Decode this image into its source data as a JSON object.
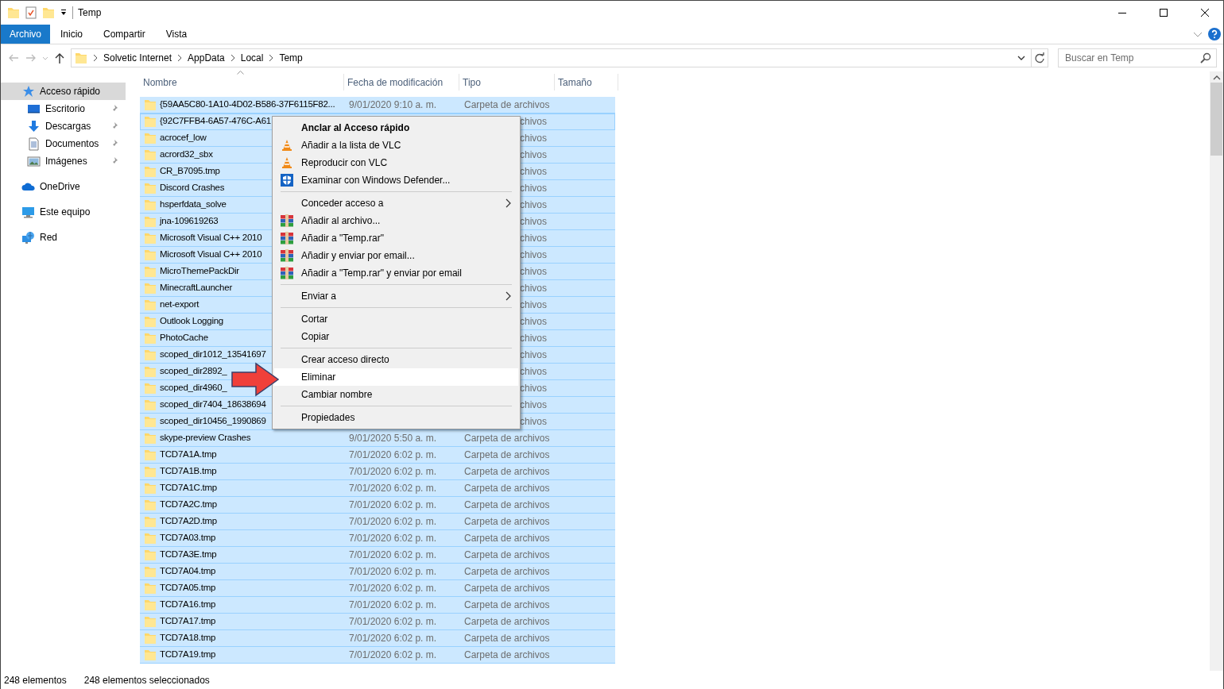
{
  "window": {
    "title": "Temp"
  },
  "ribbon_tabs": [
    {
      "label": "Archivo",
      "selected": true
    },
    {
      "label": "Inicio",
      "selected": false
    },
    {
      "label": "Compartir",
      "selected": false
    },
    {
      "label": "Vista",
      "selected": false
    }
  ],
  "address": {
    "crumbs": [
      "Solvetic Internet",
      "AppData",
      "Local",
      "Temp"
    ]
  },
  "search": {
    "placeholder": "Buscar en Temp"
  },
  "sidebar": {
    "items": [
      {
        "label": "Acceso rápido",
        "selected": true,
        "children": [
          {
            "label": "Escritorio",
            "pinned": true,
            "selected": false
          },
          {
            "label": "Descargas",
            "pinned": true,
            "selected": false
          },
          {
            "label": "Documentos",
            "pinned": true,
            "selected": false
          },
          {
            "label": "Imágenes",
            "pinned": true,
            "selected": false
          }
        ]
      },
      {
        "label": "OneDrive",
        "selected": false
      },
      {
        "label": "Este equipo",
        "selected": false
      },
      {
        "label": "Red",
        "selected": false
      }
    ]
  },
  "table": {
    "columns": [
      "Nombre",
      "Fecha de modificación",
      "Tipo",
      "Tamaño"
    ],
    "rows": [
      {
        "name": "{59AA5C80-1A10-4D02-B586-37F6115F82...",
        "date": "9/01/2020 9:10 a. m.",
        "type": "Carpeta de archivos",
        "selected": true,
        "focused": false
      },
      {
        "name": "{92C7FFB4-6A57-476C-A61",
        "type": "chivos",
        "selected": true,
        "focused": true
      },
      {
        "name": "acrocef_low",
        "type": "chivos",
        "selected": true,
        "focused": false
      },
      {
        "name": "acrord32_sbx",
        "type": "chivos",
        "selected": true,
        "focused": false
      },
      {
        "name": "CR_B7095.tmp",
        "type": "chivos",
        "selected": true,
        "focused": false
      },
      {
        "name": "Discord Crashes",
        "type": "chivos",
        "selected": true,
        "focused": false
      },
      {
        "name": "hsperfdata_solve",
        "type": "chivos",
        "selected": true,
        "focused": false
      },
      {
        "name": "jna-109619263",
        "type": "chivos",
        "selected": true,
        "focused": false
      },
      {
        "name": "Microsoft Visual C++ 2010",
        "type": "chivos",
        "selected": true,
        "focused": false
      },
      {
        "name": "Microsoft Visual C++ 2010",
        "type": "chivos",
        "selected": true,
        "focused": false
      },
      {
        "name": "MicroThemePackDir",
        "type": "chivos",
        "selected": true,
        "focused": false
      },
      {
        "name": "MinecraftLauncher",
        "type": "chivos",
        "selected": true,
        "focused": false
      },
      {
        "name": "net-export",
        "type": "chivos",
        "selected": true,
        "focused": false
      },
      {
        "name": "Outlook Logging",
        "type": "chivos",
        "selected": true,
        "focused": false
      },
      {
        "name": "PhotoCache",
        "type": "chivos",
        "selected": true,
        "focused": false
      },
      {
        "name": "scoped_dir1012_13541697",
        "type": "chivos",
        "selected": true,
        "focused": false
      },
      {
        "name": "scoped_dir2892_",
        "type": "chivos",
        "selected": true,
        "focused": false
      },
      {
        "name": "scoped_dir4960_",
        "type": "chivos",
        "selected": true,
        "focused": false
      },
      {
        "name": "scoped_dir7404_18638694",
        "type": "chivos",
        "selected": true,
        "focused": false
      },
      {
        "name": "scoped_dir10456_1990869",
        "type": "chivos",
        "selected": true,
        "focused": false
      },
      {
        "name": "skype-preview Crashes",
        "date": "9/01/2020 5:50 a. m.",
        "type": "Carpeta de archivos",
        "selected": true,
        "focused": false
      },
      {
        "name": "TCD7A1A.tmp",
        "date": "7/01/2020 6:02 p. m.",
        "type": "Carpeta de archivos",
        "selected": true,
        "focused": false
      },
      {
        "name": "TCD7A1B.tmp",
        "date": "7/01/2020 6:02 p. m.",
        "type": "Carpeta de archivos",
        "selected": true,
        "focused": false
      },
      {
        "name": "TCD7A1C.tmp",
        "date": "7/01/2020 6:02 p. m.",
        "type": "Carpeta de archivos",
        "selected": true,
        "focused": false
      },
      {
        "name": "TCD7A2C.tmp",
        "date": "7/01/2020 6:02 p. m.",
        "type": "Carpeta de archivos",
        "selected": true,
        "focused": false
      },
      {
        "name": "TCD7A2D.tmp",
        "date": "7/01/2020 6:02 p. m.",
        "type": "Carpeta de archivos",
        "selected": true,
        "focused": false
      },
      {
        "name": "TCD7A03.tmp",
        "date": "7/01/2020 6:02 p. m.",
        "type": "Carpeta de archivos",
        "selected": true,
        "focused": false
      },
      {
        "name": "TCD7A3E.tmp",
        "date": "7/01/2020 6:02 p. m.",
        "type": "Carpeta de archivos",
        "selected": true,
        "focused": false
      },
      {
        "name": "TCD7A04.tmp",
        "date": "7/01/2020 6:02 p. m.",
        "type": "Carpeta de archivos",
        "selected": true,
        "focused": false
      },
      {
        "name": "TCD7A05.tmp",
        "date": "7/01/2020 6:02 p. m.",
        "type": "Carpeta de archivos",
        "selected": true,
        "focused": false
      },
      {
        "name": "TCD7A16.tmp",
        "date": "7/01/2020 6:02 p. m.",
        "type": "Carpeta de archivos",
        "selected": true,
        "focused": false
      },
      {
        "name": "TCD7A17.tmp",
        "date": "7/01/2020 6:02 p. m.",
        "type": "Carpeta de archivos",
        "selected": true,
        "focused": false
      },
      {
        "name": "TCD7A18.tmp",
        "date": "7/01/2020 6:02 p. m.",
        "type": "Carpeta de archivos",
        "selected": true,
        "focused": false
      },
      {
        "name": "TCD7A19.tmp",
        "date": "7/01/2020 6:02 p. m.",
        "type": "Carpeta de archivos",
        "selected": true,
        "focused": false
      }
    ]
  },
  "context_menu": {
    "items": [
      {
        "kind": "plain",
        "label": "Anclar al Acceso rápido",
        "bold": true,
        "highlighted": false
      },
      {
        "kind": "media",
        "label": "Añadir a la lista de VLC",
        "highlighted": false
      },
      {
        "kind": "media",
        "label": "Reproducir con VLC",
        "highlighted": false
      },
      {
        "kind": "shield",
        "label": "Examinar con Windows Defender...",
        "highlighted": false
      },
      {
        "kind": "separator"
      },
      {
        "kind": "plain",
        "label": "Conceder acceso a",
        "submenu": true,
        "highlighted": false
      },
      {
        "kind": "archive",
        "label": "Añadir al archivo...",
        "highlighted": false
      },
      {
        "kind": "archive",
        "label": "Añadir a \"Temp.rar\"",
        "highlighted": false
      },
      {
        "kind": "archive",
        "label": "Añadir y enviar por email...",
        "highlighted": false
      },
      {
        "kind": "archive",
        "label": "Añadir a \"Temp.rar\" y enviar por email",
        "highlighted": false
      },
      {
        "kind": "separator"
      },
      {
        "kind": "plain",
        "label": "Enviar a",
        "submenu": true,
        "highlighted": false
      },
      {
        "kind": "separator"
      },
      {
        "kind": "plain",
        "label": "Cortar",
        "highlighted": false
      },
      {
        "kind": "plain",
        "label": "Copiar",
        "highlighted": false
      },
      {
        "kind": "separator"
      },
      {
        "kind": "plain",
        "label": "Crear acceso directo",
        "highlighted": false
      },
      {
        "kind": "plain",
        "label": "Eliminar",
        "highlighted": true
      },
      {
        "kind": "plain",
        "label": "Cambiar nombre",
        "highlighted": false
      },
      {
        "kind": "separator"
      },
      {
        "kind": "plain",
        "label": "Propiedades",
        "highlighted": false
      }
    ]
  },
  "status_bar": {
    "count": "248 elementos",
    "selection": "248 elementos seleccionados"
  }
}
